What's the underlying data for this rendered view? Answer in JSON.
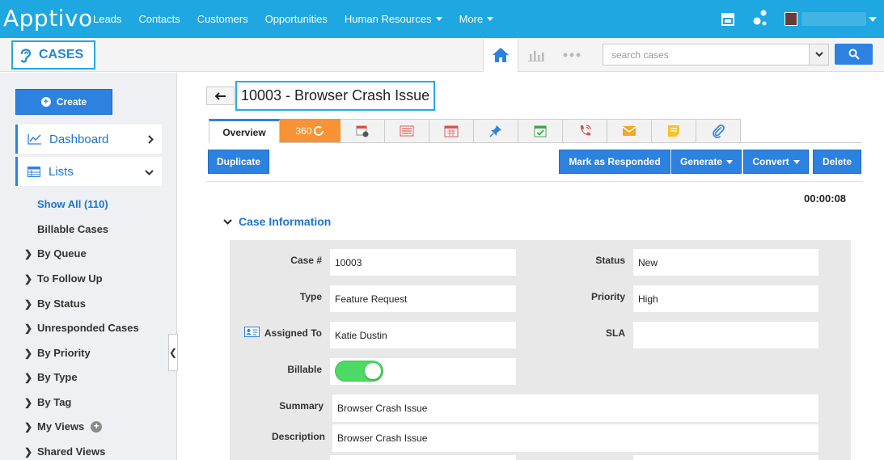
{
  "topnav": {
    "logo": "Apptivo",
    "items": [
      {
        "label": "Leads"
      },
      {
        "label": "Contacts"
      },
      {
        "label": "Customers"
      },
      {
        "label": "Opportunities"
      },
      {
        "label": "Human Resources",
        "dropdown": true
      },
      {
        "label": "More",
        "dropdown": true
      }
    ]
  },
  "appbar": {
    "app_name": "CASES",
    "search_placeholder": "search cases"
  },
  "sidebar": {
    "create_label": "Create",
    "dashboard_label": "Dashboard",
    "lists_label": "Lists",
    "links": [
      "Show All (110)",
      "Billable Cases"
    ],
    "groups": [
      "By Queue",
      "To Follow Up",
      "By Status",
      "Unresponded Cases",
      "By Priority",
      "By Type",
      "By Tag",
      "My Views",
      "Shared Views"
    ]
  },
  "record": {
    "title": "10003 - Browser Crash Issue",
    "tab_overview": "Overview",
    "tab_360": "360",
    "timer": "00:00:08",
    "section_title": "Case Information"
  },
  "actions": {
    "duplicate": "Duplicate",
    "mark_responded": "Mark as Responded",
    "generate": "Generate",
    "convert": "Convert",
    "delete": "Delete"
  },
  "fields": {
    "case_no_label": "Case #",
    "case_no": "10003",
    "status_label": "Status",
    "status": "New",
    "type_label": "Type",
    "type": "Feature Request",
    "priority_label": "Priority",
    "priority": "High",
    "assigned_label": "Assigned To",
    "assigned": "Katie Dustin",
    "sla_label": "SLA",
    "sla": "",
    "billable_label": "Billable",
    "billable": true,
    "summary_label": "Summary",
    "summary": "Browser Crash Issue",
    "description_label": "Description",
    "description": "Browser Crash Issue"
  },
  "colors": {
    "topbar": "#1ea7e1",
    "primary_button": "#2d82e0",
    "tab_360": "#f79334",
    "toggle_on": "#4cd964"
  }
}
